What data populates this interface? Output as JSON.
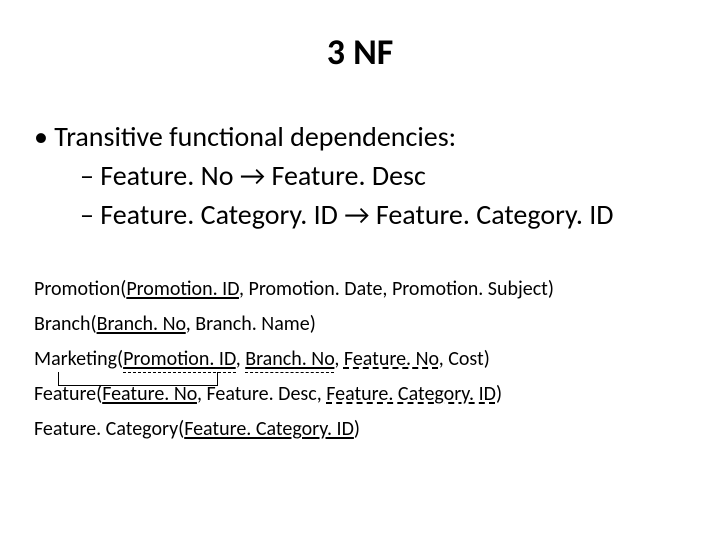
{
  "title": "3 NF",
  "bullets": {
    "main": "Transitive functional dependencies:",
    "sub1_left": "Feature. No",
    "sub1_right": "Feature. Desc",
    "sub2_left": "Feature. Category. ID",
    "sub2_right": "Feature. Category. ID"
  },
  "relations": {
    "r1": {
      "head": "Promotion(",
      "k1": "Promotion. ID",
      "rest": ", Promotion. Date, Promotion. Subject)"
    },
    "r2": {
      "head": "Branch(",
      "k1": "Branch. No",
      "rest": ", Branch. Name)"
    },
    "r3": {
      "head": "Marketing(",
      "k1": "Promotion. ID",
      "sep1": ", ",
      "k2": "Branch. No",
      "sep2": ", ",
      "fk1": "Feature. No",
      "rest": ", Cost)"
    },
    "r4": {
      "head": "Feature(",
      "k1": "Feature. No",
      "mid": ", Feature. Desc, ",
      "fk1": "Feature. Category. ID",
      "tail": ")"
    },
    "r5": {
      "head": "Feature. Category(",
      "k1": "Feature. Category. ID",
      "tail": ")"
    }
  }
}
